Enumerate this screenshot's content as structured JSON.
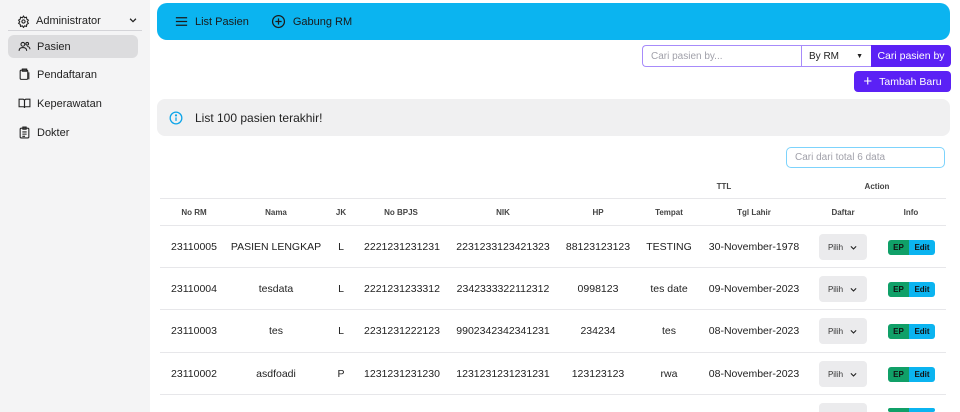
{
  "sidebar": {
    "admin_label": "Administrator",
    "items": [
      {
        "label": "Pasien",
        "icon": "users-icon",
        "active": true
      },
      {
        "label": "Pendaftaran",
        "icon": "clipboard-icon",
        "active": false
      },
      {
        "label": "Keperawatan",
        "icon": "book-open-icon",
        "active": false
      },
      {
        "label": "Dokter",
        "icon": "clipboard-list-icon",
        "active": false
      }
    ]
  },
  "topbar": {
    "list_label": "List Pasien",
    "gabung_label": "Gabung RM"
  },
  "search": {
    "placeholder": "Cari pasien by...",
    "by_value": "By RM",
    "button_label": "Cari pasien by"
  },
  "add_button_label": "Tambah Baru",
  "info_text": "List 100 pasien terakhir!",
  "table_search_placeholder": "Cari dari total 6 data",
  "table": {
    "group_headers": {
      "ttl": "TTL",
      "action": "Action"
    },
    "columns": [
      "No RM",
      "Nama",
      "JK",
      "No BPJS",
      "NIK",
      "HP",
      "Tempat",
      "Tgl Lahir",
      "Daftar",
      "Info"
    ],
    "rows": [
      {
        "no_rm": "23110005",
        "nama": "PASIEN LENGKAP",
        "jk": "L",
        "bpjs": "2221231231231",
        "nik": "2231233123421323",
        "hp": "88123123123",
        "tempat": "TESTING",
        "tgl": "30-November-1978"
      },
      {
        "no_rm": "23110004",
        "nama": "tesdata",
        "jk": "L",
        "bpjs": "2221231233312",
        "nik": "2342333322112312",
        "hp": "0998123",
        "tempat": "tes date",
        "tgl": "09-November-2023"
      },
      {
        "no_rm": "23110003",
        "nama": "tes",
        "jk": "L",
        "bpjs": "2231231222123",
        "nik": "9902342342341231",
        "hp": "234234",
        "tempat": "tes",
        "tgl": "08-November-2023"
      },
      {
        "no_rm": "23110002",
        "nama": "asdfoadi",
        "jk": "P",
        "bpjs": "1231231231230",
        "nik": "1231231231231231",
        "hp": "123123123",
        "tempat": "rwa",
        "tgl": "08-November-2023"
      }
    ],
    "pilih_label": "Pilih",
    "ep_label": "EP",
    "edit_label": "Edit"
  },
  "colors": {
    "topbar": "#0bb4f0",
    "primary": "#5b21f5",
    "ep": "#10a068",
    "edit": "#0bb4f0"
  }
}
